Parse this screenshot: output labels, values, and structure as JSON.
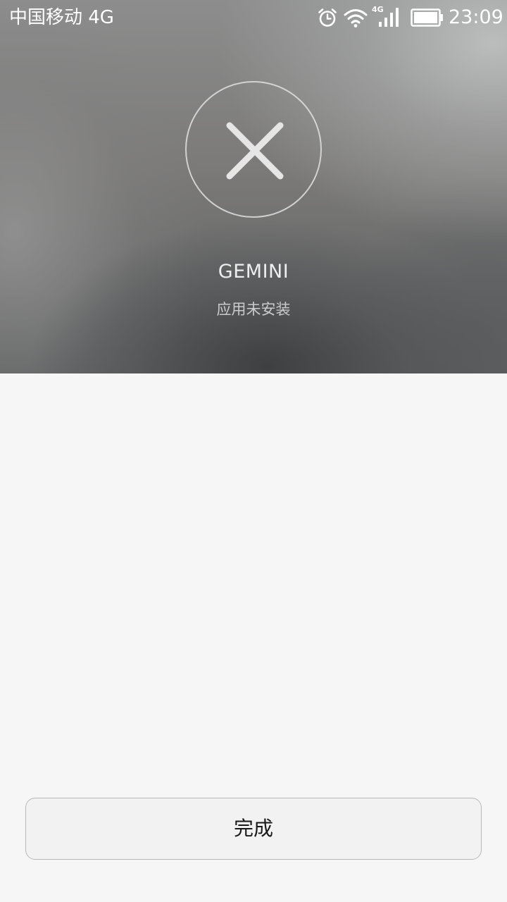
{
  "status_bar": {
    "carrier": "中国移动 4G",
    "network_badge": "4G",
    "time": "23:09",
    "icons": [
      "alarm-icon",
      "wifi-icon",
      "signal-icon",
      "battery-icon"
    ]
  },
  "result": {
    "icon": "close-icon",
    "app_name": "GEMINI",
    "status": "应用未安装"
  },
  "footer": {
    "done_label": "完成"
  },
  "colors": {
    "background": "#f6f6f6",
    "button_border": "#b8b8b8",
    "icon_stroke": "#e6e6e6"
  }
}
